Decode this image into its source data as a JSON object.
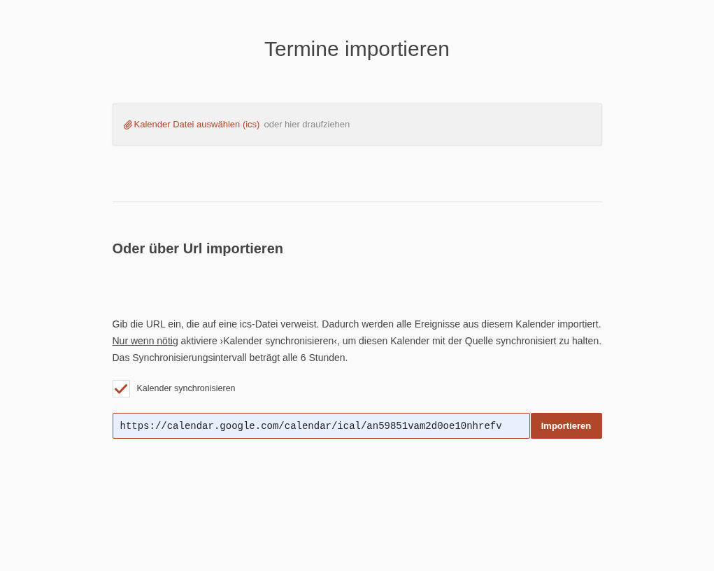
{
  "page": {
    "title": "Termine importieren"
  },
  "file_drop": {
    "link": "Kalender Datei auswählen (ics)",
    "hint": "oder hier draufziehen"
  },
  "url_import": {
    "heading": "Oder über Url importieren",
    "description": "Gib die URL ein, die auf eine ics-Datei verweist. Dadurch werden alle Ereignisse aus diesem Kalender importiert.",
    "note": {
      "link": "Nur wenn nötig",
      "text": "aktiviere ›Kalender synchronisieren‹, um diesen Kalender mit der Quelle synchronisiert zu halten. Das Synchronisierungsintervall beträgt alle 6 Stunden."
    },
    "sync_checkbox": {
      "label": "Kalender synchronisieren",
      "checked": true
    },
    "url_field": {
      "value": "https://calendar.google.com/calendar/ical/an59851vam2d0oe10nhrefv"
    },
    "button": "Importieren"
  }
}
